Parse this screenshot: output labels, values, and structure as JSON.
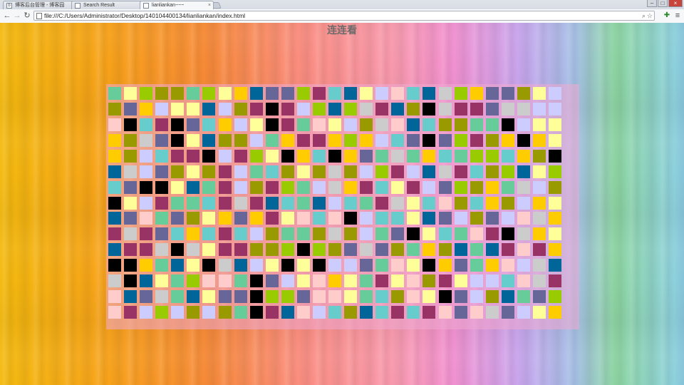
{
  "browser": {
    "tabs": [
      {
        "label": "博客后台管理 - 博客园",
        "favicon": "blog-favicon",
        "active": false
      },
      {
        "label": "Search Result",
        "favicon": "page-favicon",
        "active": false
      },
      {
        "label": "lianliankan~~~",
        "favicon": "page-favicon",
        "active": true
      }
    ],
    "url": "file:///C:/Users/Administrator/Desktop/140104400134/lianliankan/index.html",
    "icons": {
      "back": "back-arrow-icon",
      "forward": "forward-arrow-icon",
      "reload": "reload-icon",
      "zoom": "magnifier-icon",
      "bookmark": "star-icon",
      "extension": "puzzle-icon",
      "menu": "hamburger-menu-icon",
      "minimize": "minimize-icon",
      "maximize": "maximize-icon",
      "close": "close-icon"
    }
  },
  "page": {
    "title": "连连看"
  },
  "board": {
    "rows": 15,
    "cols": 29,
    "palette": {
      "A": "#66cc99",
      "B": "#ffff99",
      "C": "#99cc00",
      "D": "#999900",
      "E": "#ffcc00",
      "F": "#006699",
      "G": "#666699",
      "H": "#993366",
      "I": "#66cccc",
      "J": "#ffcccc",
      "K": "#ccccff",
      "L": "#cccccc",
      "M": "#000000"
    },
    "grid": [
      "ABCDDACBEFGGCHIFBKJIFLCEGGDBK",
      "DGEKBBFKDHMHKCFCLHFDMLHHGLLKK",
      "JMIHMGIEKBMHAJBKDLJFIDDAAMKBB",
      "EDLGMBFDDKAEHHECEKIGMGCHDEMEB",
      "EDKIHHMKHCBMEIMEGALAEIACCIEDM",
      "FLKGDBDHKAIDBDLDKCHKFLHIDCFBC",
      "IGMMBFAHKDHCAKLEHIBHKGCDEALKD",
      "MBKHAAIHLHFIAFKIAHLBIJDIEDKEB",
      "FGJAGDBEGEHBJIJMKIIBFGKDGKJLE",
      "HLHGIEIHIKDAADLDKAGMBIAJHMLEB",
      "FHHLMLBHHDDCMCDGLGDAEDFAFHJHE",
      "MMEAFBMLFKBMBMKKGAJBMEGAEJKLF",
      "LMFBACJJAMGKBJEBAHBJDHBKKIJLH",
      "JFGLAFBGGMCCGJJBAIDJBMGKDFAGC",
      "JHKCKDKDAMHFJKIDFIHIHJGJLGKBE"
    ]
  }
}
